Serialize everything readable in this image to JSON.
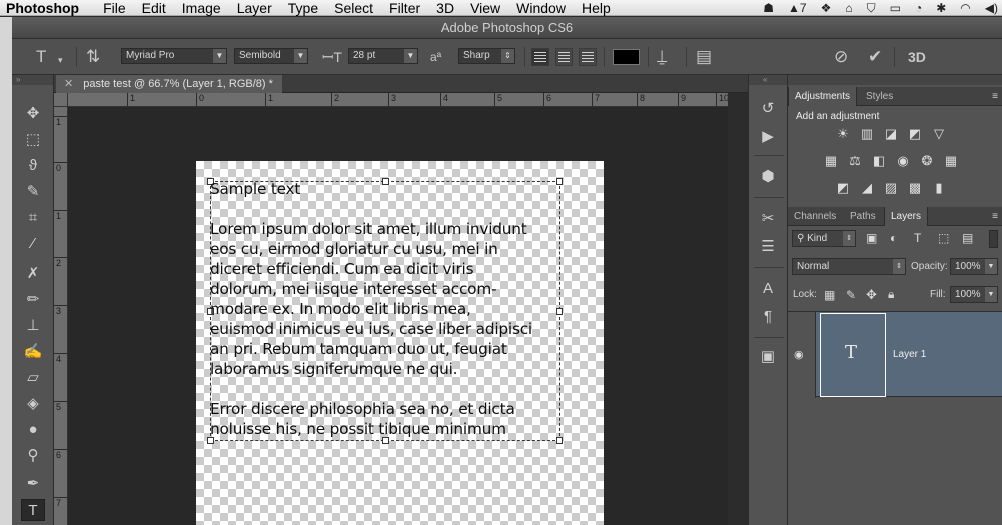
{
  "menubar": {
    "app": "Photoshop",
    "items": [
      "File",
      "Edit",
      "Image",
      "Layer",
      "Type",
      "Select",
      "Filter",
      "3D",
      "View",
      "Window",
      "Help"
    ],
    "status_text": "7"
  },
  "window": {
    "title": "Adobe Photoshop CS6"
  },
  "options": {
    "font_family": "Myriad Pro",
    "font_style": "Semibold",
    "font_size": "28 pt",
    "aa_label": "a",
    "anti_alias": "Sharp",
    "text_color": "#000000",
    "threed": "3D"
  },
  "document": {
    "tab_label": "paste test @ 66.7% (Layer 1, RGB/8) *",
    "ruler_h": [
      "1",
      "0",
      "1",
      "2",
      "3",
      "4",
      "5",
      "6",
      "7",
      "8",
      "9",
      "10"
    ],
    "ruler_v": [
      "1",
      "0",
      "1",
      "2",
      "3",
      "4",
      "5",
      "6",
      "7"
    ],
    "heading": "Sample text",
    "para1": "Lorem ipsum dolor sit amet, illum invidunt\neos cu, eirmod gloriatur cu usu, mei in\ndiceret efficiendi. Cum ea dicit viris\ndolorum, mei iisque interesset accom-\nmodare ex. In modo elit libris mea,\neuismod inimicus eu ius, case liber adipisci\nan pri. Rebum tamquam duo ut, feugiat\nlaboramus signiferumque ne qui.",
    "para2": "Error discere philosophia sea no, et dicta\nnoluisse his, ne possit tibique minimum"
  },
  "panels": {
    "adjustments": {
      "tabs": [
        "Adjustments",
        "Styles"
      ],
      "add_label": "Add an adjustment"
    },
    "layers": {
      "tabs": [
        "Channels",
        "Paths",
        "Layers"
      ],
      "filter_kind": "Kind",
      "blend_mode": "Normal",
      "opacity_label": "Opacity:",
      "opacity": "100%",
      "lock_label": "Lock:",
      "fill_label": "Fill:",
      "fill": "100%",
      "layer_name": "Layer 1",
      "layer_thumb": "T"
    }
  }
}
